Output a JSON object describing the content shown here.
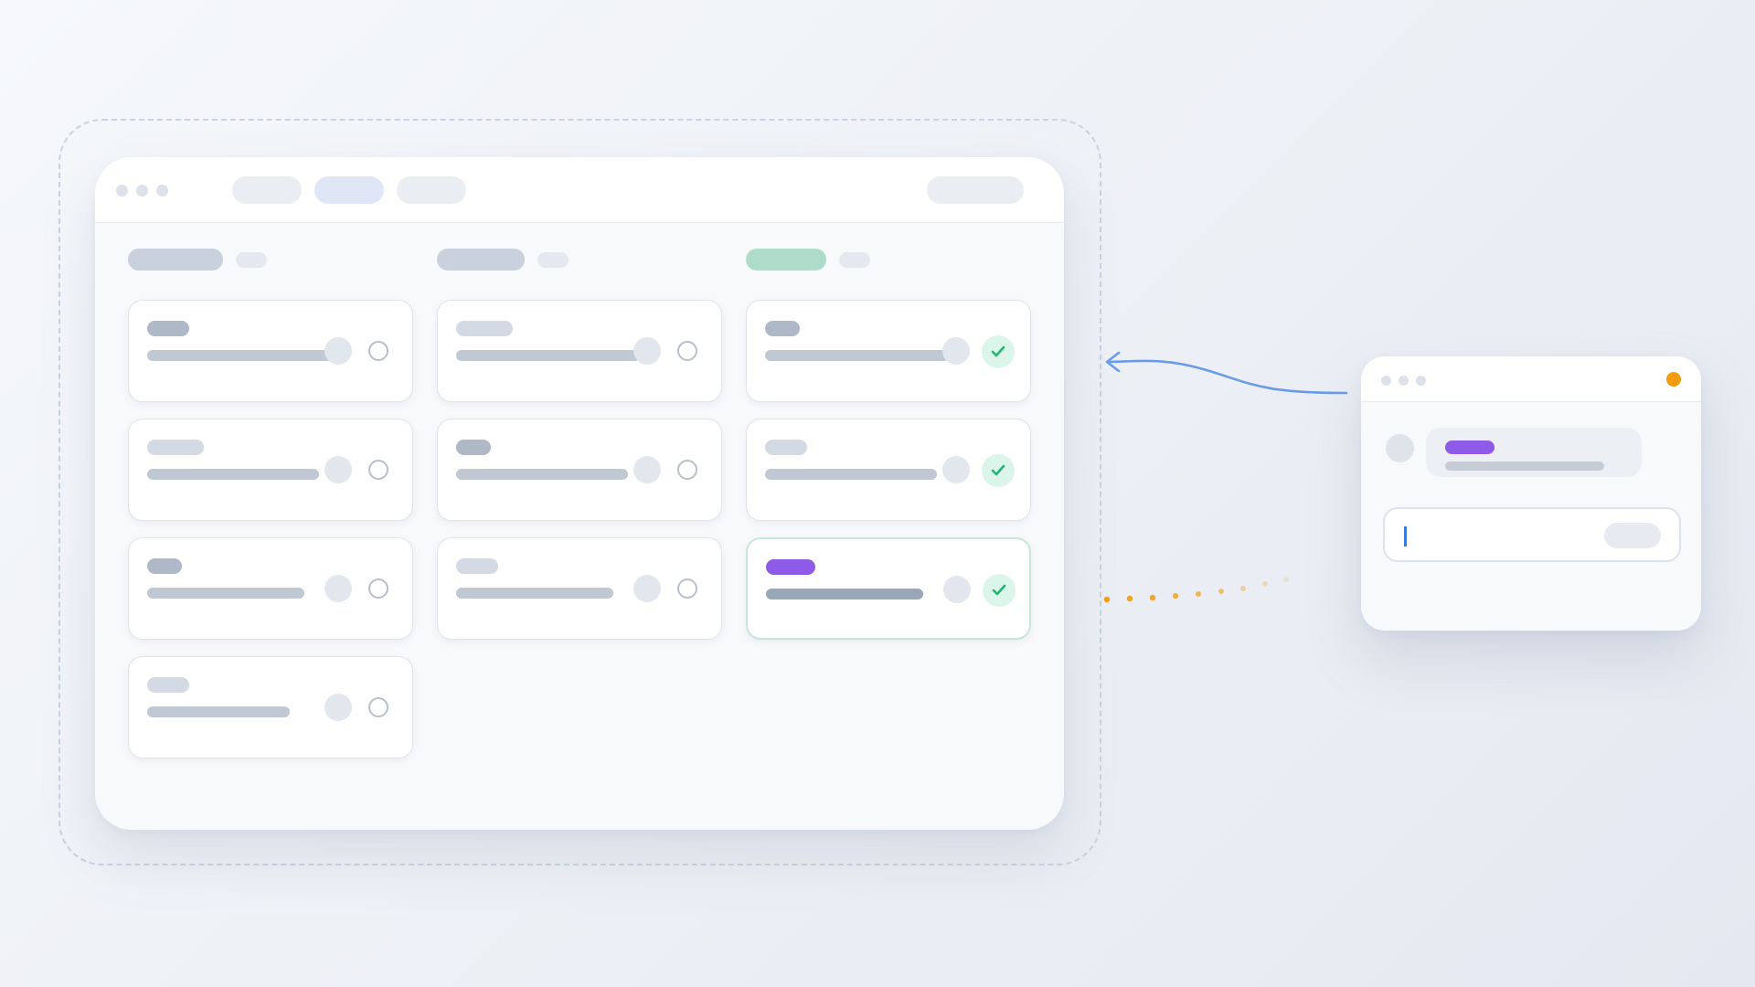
{
  "colors": {
    "accent_blue": "#6b9be8",
    "accent_orange": "#f39c12",
    "accent_purple": "#8e5ae8",
    "done_green": "#22b573",
    "tab_active": "#dfe7f7"
  },
  "board": {
    "tabs": [
      {
        "state": "default"
      },
      {
        "state": "active"
      },
      {
        "state": "default"
      }
    ],
    "columns": [
      {
        "id": "todo",
        "header_color": "#c9d1dc",
        "cards": [
          {
            "tag_color": "#aeb8c6",
            "done": false
          },
          {
            "tag_color": "#d4dae3",
            "done": false
          },
          {
            "tag_color": "#aeb8c6",
            "done": false
          },
          {
            "tag_color": "#d4dae3",
            "done": false
          }
        ]
      },
      {
        "id": "in-progress",
        "header_color": "#c9d1dc",
        "cards": [
          {
            "tag_color": "#d4dae3",
            "done": false
          },
          {
            "tag_color": "#aeb8c6",
            "done": false
          },
          {
            "tag_color": "#d4dae3",
            "done": false
          }
        ]
      },
      {
        "id": "done",
        "header_color": "#afdcca",
        "cards": [
          {
            "tag_color": "#aeb8c6",
            "done": true
          },
          {
            "tag_color": "#d4dae3",
            "done": true
          },
          {
            "tag_color": "#8e5ae8",
            "done": true,
            "highlight": true
          }
        ]
      }
    ]
  },
  "chat_window": {
    "has_notification": true,
    "notification_color": "#f39c12",
    "message_tag_color": "#8e5ae8"
  },
  "connectors": {
    "arrow_color": "#6b9be8",
    "dotted_color": "#f39c12"
  }
}
